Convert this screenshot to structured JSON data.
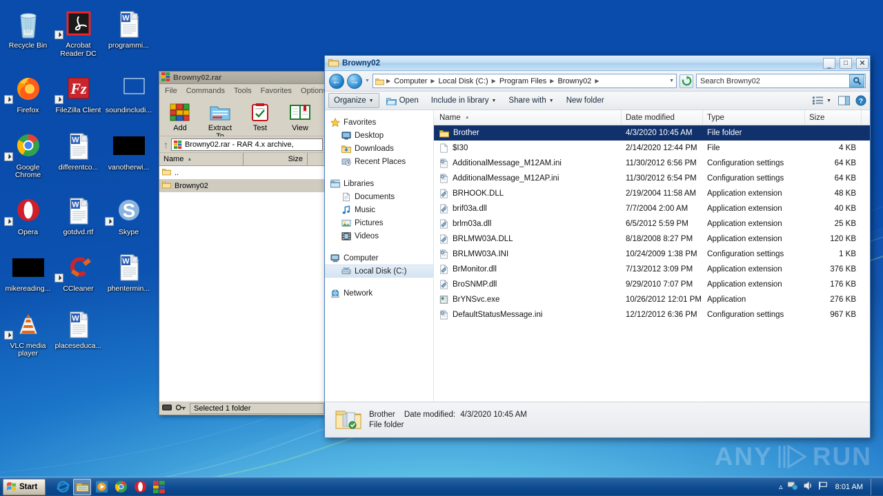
{
  "desktop": {
    "icons": [
      {
        "label": "Recycle Bin",
        "icon": "recycle-bin-icon",
        "shortcut": false,
        "kind": "recyclebin"
      },
      {
        "label": "Acrobat Reader DC",
        "icon": "acrobat-reader-icon",
        "shortcut": true,
        "kind": "acrobat"
      },
      {
        "label": "programmi...",
        "icon": "word-document-icon",
        "shortcut": false,
        "kind": "word"
      },
      {
        "label": "Firefox",
        "icon": "firefox-icon",
        "shortcut": true,
        "kind": "firefox"
      },
      {
        "label": "FileZilla Client",
        "icon": "filezilla-icon",
        "shortcut": true,
        "kind": "filezilla"
      },
      {
        "label": "soundincludi...",
        "icon": "redacted-thumbnail-icon",
        "shortcut": false,
        "kind": "blank"
      },
      {
        "label": "Google Chrome",
        "icon": "chrome-icon",
        "shortcut": true,
        "kind": "chrome"
      },
      {
        "label": "differentco...",
        "icon": "word-document-icon",
        "shortcut": false,
        "kind": "word"
      },
      {
        "label": "vanotherwi...",
        "icon": "redacted-thumbnail-icon",
        "shortcut": false,
        "kind": "black"
      },
      {
        "label": "Opera",
        "icon": "opera-icon",
        "shortcut": true,
        "kind": "opera"
      },
      {
        "label": "gotdvd.rtf",
        "icon": "word-document-icon",
        "shortcut": false,
        "kind": "word"
      },
      {
        "label": "Skype",
        "icon": "skype-icon",
        "shortcut": true,
        "kind": "skype"
      },
      {
        "label": "mikereading...",
        "icon": "redacted-thumbnail-icon",
        "shortcut": false,
        "kind": "black"
      },
      {
        "label": "CCleaner",
        "icon": "ccleaner-icon",
        "shortcut": true,
        "kind": "ccleaner"
      },
      {
        "label": "phentermin...",
        "icon": "word-document-icon",
        "shortcut": false,
        "kind": "word"
      },
      {
        "label": "VLC media player",
        "icon": "vlc-icon",
        "shortcut": true,
        "kind": "vlc"
      },
      {
        "label": "placeseduca...",
        "icon": "word-document-icon",
        "shortcut": false,
        "kind": "word"
      }
    ]
  },
  "winrar": {
    "title": "Browny02.rar",
    "menus": [
      "File",
      "Commands",
      "Tools",
      "Favorites",
      "Options"
    ],
    "toolbar": [
      {
        "label": "Add",
        "icon": "rar-add-icon"
      },
      {
        "label": "Extract To",
        "icon": "extract-to-icon"
      },
      {
        "label": "Test",
        "icon": "test-icon"
      },
      {
        "label": "View",
        "icon": "view-icon"
      }
    ],
    "address_value": "Browny02.rar - RAR 4.x archive, ",
    "columns": [
      "Name",
      "Size"
    ],
    "rows": [
      {
        "name": "..",
        "size": "",
        "selected": false,
        "icon": "folder-up-icon"
      },
      {
        "name": "Browny02",
        "size": "",
        "selected": true,
        "icon": "folder-icon"
      }
    ],
    "status": "Selected 1 folder"
  },
  "explorer": {
    "title": "Browny02",
    "window_buttons": {
      "minimize": "_",
      "maximize": "□",
      "close": "✕"
    },
    "breadcrumb": [
      "Computer",
      "Local Disk (C:)",
      "Program Files",
      "Browny02"
    ],
    "search": {
      "placeholder": "Search Browny02",
      "value": "Search Browny02"
    },
    "commands": [
      {
        "label": "Organize",
        "caret": true,
        "active": true,
        "icon": null
      },
      {
        "label": "Open",
        "caret": false,
        "active": false,
        "icon": "open-folder-icon"
      },
      {
        "label": "Include in library",
        "caret": true,
        "active": false,
        "icon": null
      },
      {
        "label": "Share with",
        "caret": true,
        "active": false,
        "icon": null
      },
      {
        "label": "New folder",
        "caret": false,
        "active": false,
        "icon": null
      }
    ],
    "nav_pane": [
      {
        "label": "Favorites",
        "level": 0,
        "icon": "star-icon",
        "selected": false
      },
      {
        "label": "Desktop",
        "level": 1,
        "icon": "desktop-icon",
        "selected": false
      },
      {
        "label": "Downloads",
        "level": 1,
        "icon": "downloads-icon",
        "selected": false
      },
      {
        "label": "Recent Places",
        "level": 1,
        "icon": "recent-places-icon",
        "selected": false
      },
      {
        "label": "Libraries",
        "level": 0,
        "icon": "libraries-icon",
        "selected": false
      },
      {
        "label": "Documents",
        "level": 1,
        "icon": "documents-icon",
        "selected": false
      },
      {
        "label": "Music",
        "level": 1,
        "icon": "music-icon",
        "selected": false
      },
      {
        "label": "Pictures",
        "level": 1,
        "icon": "pictures-icon",
        "selected": false
      },
      {
        "label": "Videos",
        "level": 1,
        "icon": "videos-icon",
        "selected": false
      },
      {
        "label": "Computer",
        "level": 0,
        "icon": "computer-icon",
        "selected": false
      },
      {
        "label": "Local Disk (C:)",
        "level": 1,
        "icon": "harddisk-icon",
        "selected": true
      },
      {
        "label": "Network",
        "level": 0,
        "icon": "network-icon",
        "selected": false
      }
    ],
    "columns": [
      "Name",
      "Date modified",
      "Type",
      "Size"
    ],
    "sort_column": "Name",
    "sort_direction": "ascending",
    "files": [
      {
        "name": "Brother",
        "date": "4/3/2020 10:45 AM",
        "type": "File folder",
        "size": "",
        "icon": "folder-icon",
        "selected": true
      },
      {
        "name": "$I30",
        "date": "2/14/2020 12:44 PM",
        "type": "File",
        "size": "4 KB",
        "icon": "blank-file-icon",
        "selected": false
      },
      {
        "name": "AdditionalMessage_M12AM.ini",
        "date": "11/30/2012 6:56 PM",
        "type": "Configuration settings",
        "size": "64 KB",
        "icon": "ini-file-icon",
        "selected": false
      },
      {
        "name": "AdditionalMessage_M12AP.ini",
        "date": "11/30/2012 6:54 PM",
        "type": "Configuration settings",
        "size": "64 KB",
        "icon": "ini-file-icon",
        "selected": false
      },
      {
        "name": "BRHOOK.DLL",
        "date": "2/19/2004 11:58 AM",
        "type": "Application extension",
        "size": "48 KB",
        "icon": "dll-file-icon",
        "selected": false
      },
      {
        "name": "brif03a.dll",
        "date": "7/7/2004 2:00 AM",
        "type": "Application extension",
        "size": "40 KB",
        "icon": "dll-file-icon",
        "selected": false
      },
      {
        "name": "brlm03a.dll",
        "date": "6/5/2012 5:59 PM",
        "type": "Application extension",
        "size": "25 KB",
        "icon": "dll-file-icon",
        "selected": false
      },
      {
        "name": "BRLMW03A.DLL",
        "date": "8/18/2008 8:27 PM",
        "type": "Application extension",
        "size": "120 KB",
        "icon": "dll-file-icon",
        "selected": false
      },
      {
        "name": "BRLMW03A.INI",
        "date": "10/24/2009 1:38 PM",
        "type": "Configuration settings",
        "size": "1 KB",
        "icon": "ini-file-icon",
        "selected": false
      },
      {
        "name": "BrMonitor.dll",
        "date": "7/13/2012 3:09 PM",
        "type": "Application extension",
        "size": "376 KB",
        "icon": "dll-file-icon",
        "selected": false
      },
      {
        "name": "BroSNMP.dll",
        "date": "9/29/2010 7:07 PM",
        "type": "Application extension",
        "size": "176 KB",
        "icon": "dll-file-icon",
        "selected": false
      },
      {
        "name": "BrYNSvc.exe",
        "date": "10/26/2012 12:01 PM",
        "type": "Application",
        "size": "276 KB",
        "icon": "exe-file-icon",
        "selected": false
      },
      {
        "name": "DefaultStatusMessage.ini",
        "date": "12/12/2012 6:36 PM",
        "type": "Configuration settings",
        "size": "967 KB",
        "icon": "ini-file-icon",
        "selected": false
      }
    ],
    "details": {
      "name": "Brother",
      "date_label": "Date modified:",
      "date_value": "4/3/2020 10:45 AM",
      "type": "File folder",
      "icon": "folder-large-icon"
    }
  },
  "taskbar": {
    "start_label": "Start",
    "items": [
      {
        "name": "internet-explorer-icon",
        "active": false
      },
      {
        "name": "windows-explorer-icon",
        "active": true
      },
      {
        "name": "media-player-icon",
        "active": false
      },
      {
        "name": "chrome-icon",
        "active": false
      },
      {
        "name": "opera-icon",
        "active": false
      },
      {
        "name": "winrar-icon",
        "active": false
      }
    ],
    "tray": [
      "show-hidden-icons",
      "network-icon",
      "volume-icon",
      "flag-action-center-icon"
    ],
    "clock": "8:01 AM"
  },
  "watermark": {
    "text_left": "ANY",
    "text_right": "RUN"
  },
  "colors": {
    "desktop_top": "#0a4fad",
    "desktop_bottom": "#5cc4e8",
    "selection": "#10316b",
    "explorer_frame": "#4a7ebb",
    "winrar_chrome": "#d6d2c6",
    "taskbar": "#0f4d93"
  }
}
